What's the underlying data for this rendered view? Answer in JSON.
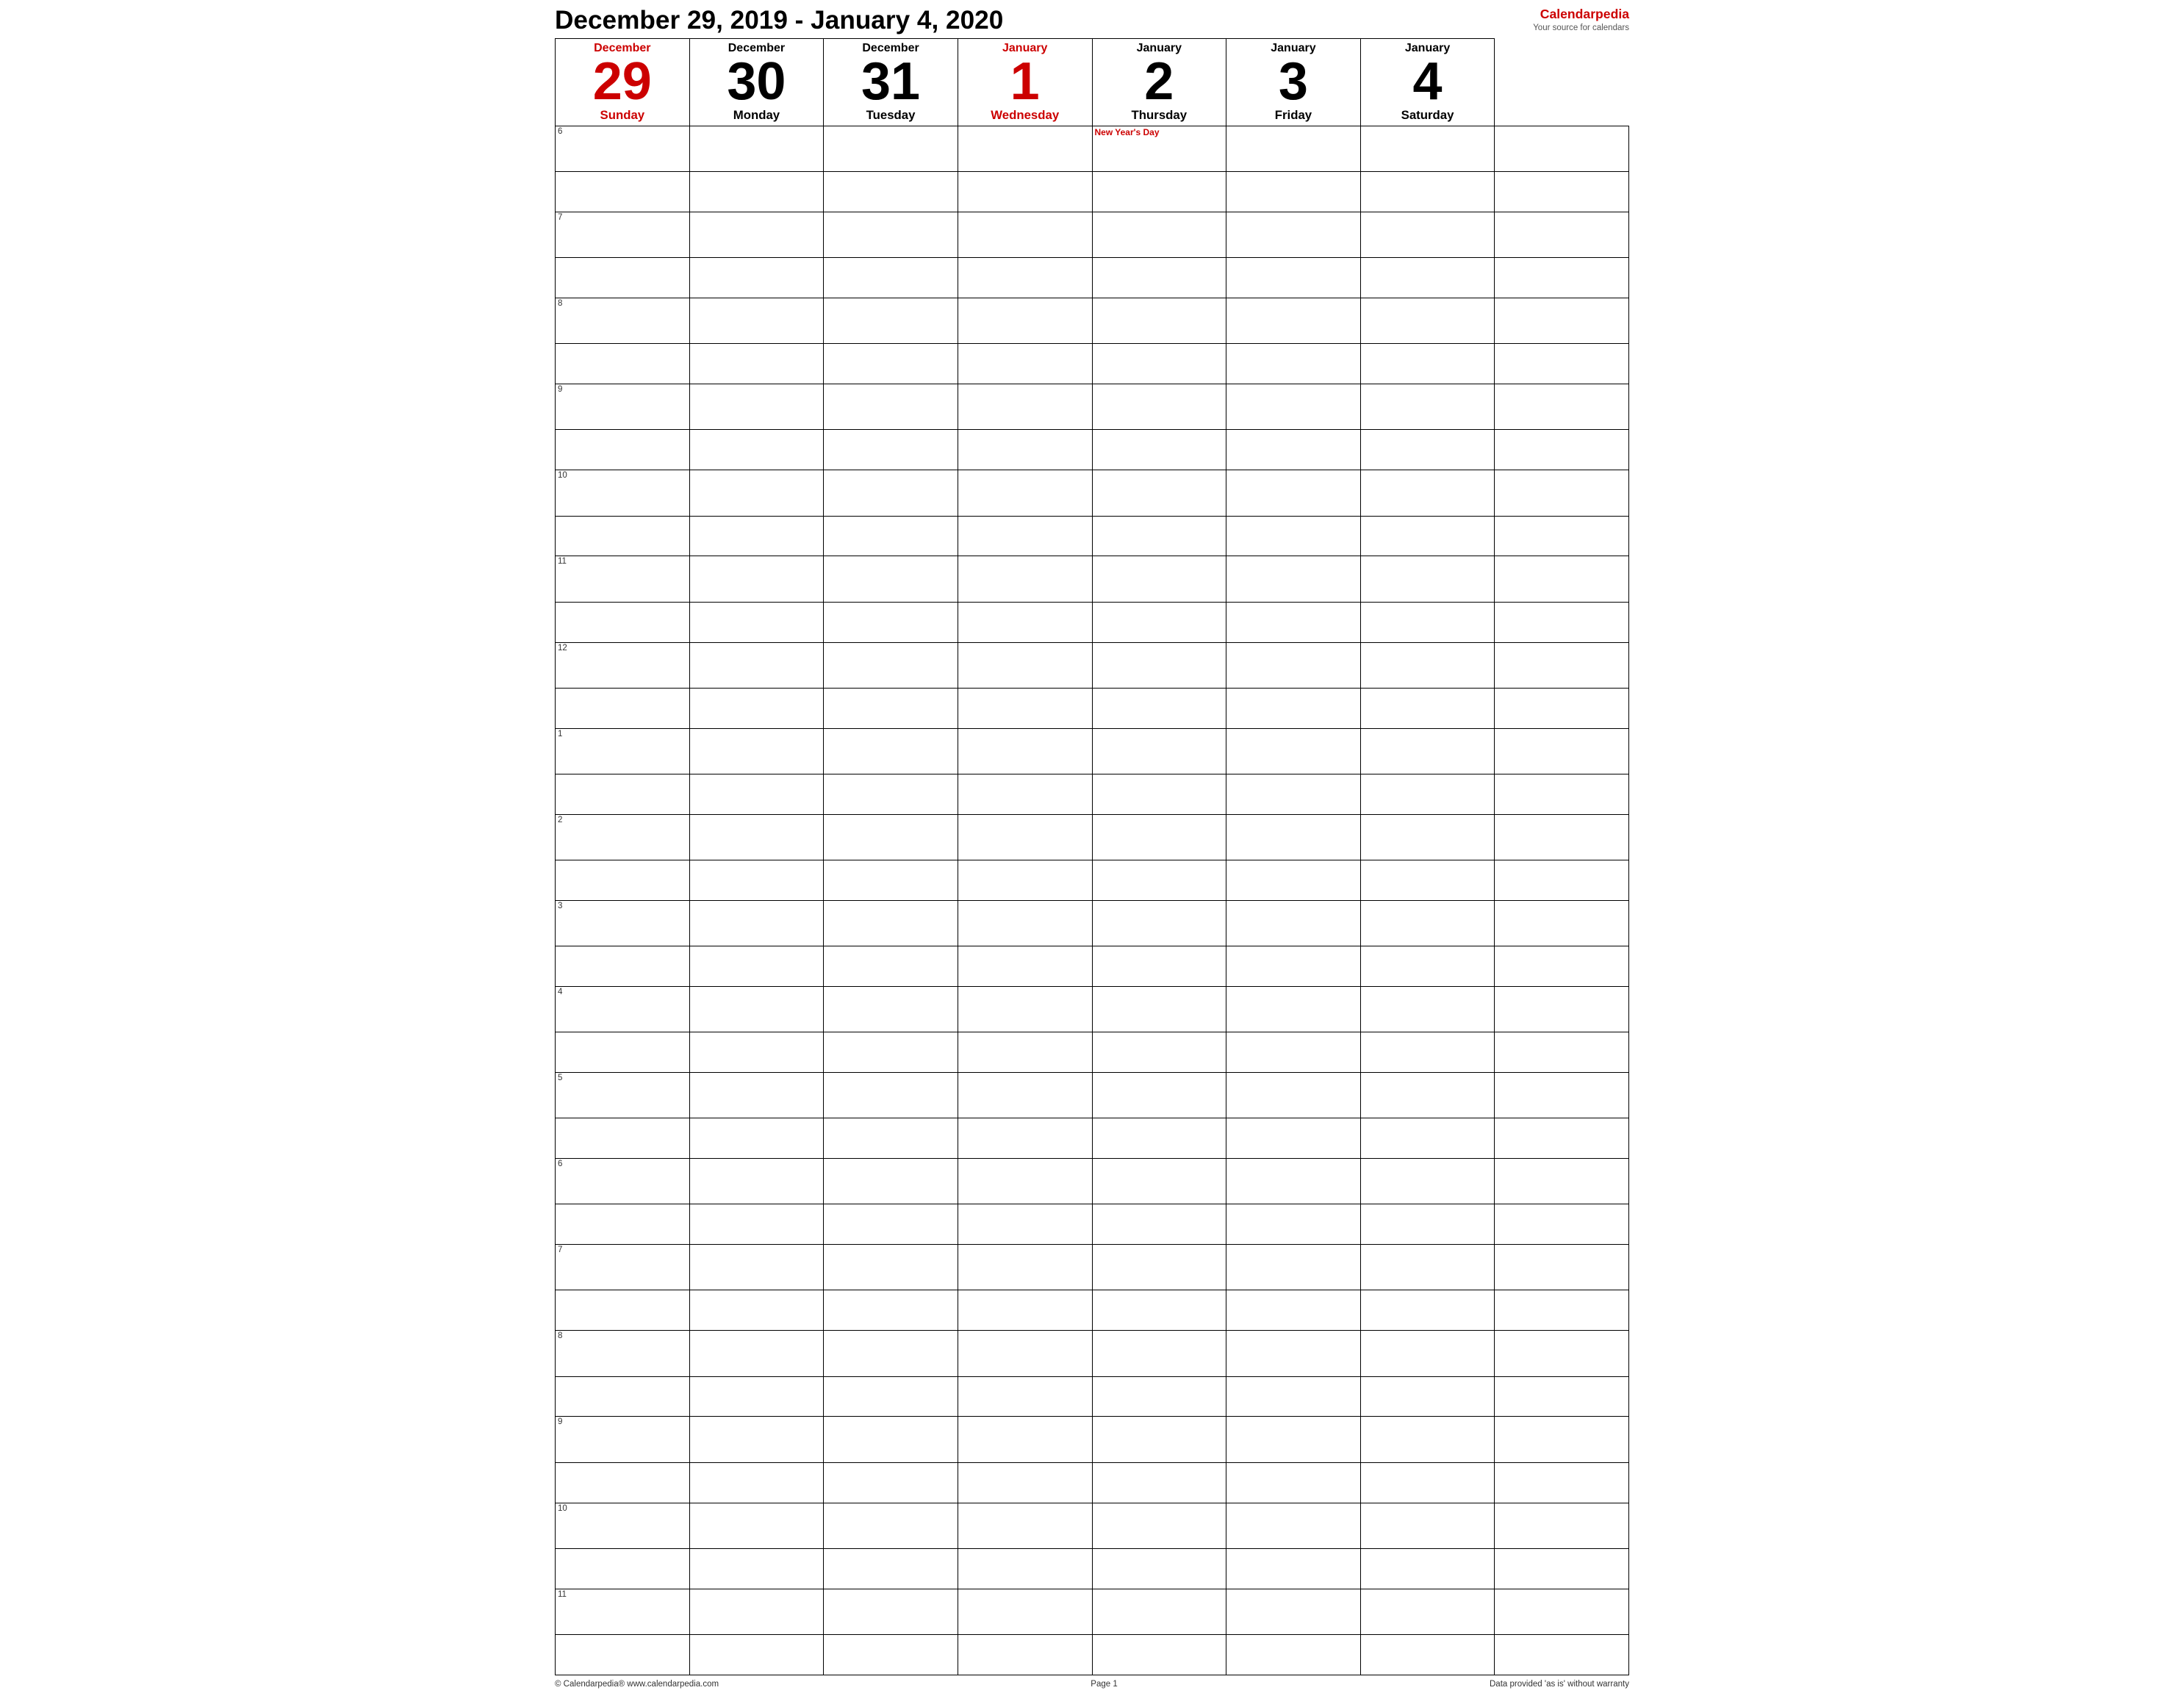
{
  "header": {
    "title": "December 29, 2019 - January 4, 2020"
  },
  "logo": {
    "name_part1": "Calendar",
    "name_part2": "pedia",
    "tagline": "Your source for calendars"
  },
  "days": [
    {
      "month": "December",
      "number": "29",
      "name": "Sunday",
      "red": true
    },
    {
      "month": "December",
      "number": "30",
      "name": "Monday",
      "red": false
    },
    {
      "month": "December",
      "number": "31",
      "name": "Tuesday",
      "red": false
    },
    {
      "month": "January",
      "number": "1",
      "name": "Wednesday",
      "red": true
    },
    {
      "month": "January",
      "number": "2",
      "name": "Thursday",
      "red": false
    },
    {
      "month": "January",
      "number": "3",
      "name": "Friday",
      "red": false
    },
    {
      "month": "January",
      "number": "4",
      "name": "Saturday",
      "red": false
    }
  ],
  "time_slots": [
    "6",
    "",
    "7",
    "",
    "8",
    "",
    "9",
    "",
    "10",
    "",
    "11",
    "",
    "12",
    "",
    "1",
    "",
    "2",
    "",
    "3",
    "",
    "4",
    "",
    "5",
    "",
    "6",
    "",
    "7",
    "",
    "8",
    "",
    "9",
    "",
    "10",
    "",
    "11",
    ""
  ],
  "time_labels": [
    "6",
    "7",
    "8",
    "9",
    "10",
    "11",
    "12",
    "1",
    "2",
    "3",
    "4",
    "5",
    "6",
    "7",
    "8",
    "9",
    "10",
    "11"
  ],
  "events": {
    "jan1_6am": "New Year's Day"
  },
  "footer": {
    "left": "© Calendarpedia®   www.calendarpedia.com",
    "center": "Page 1",
    "right": "Data provided 'as is' without warranty"
  }
}
